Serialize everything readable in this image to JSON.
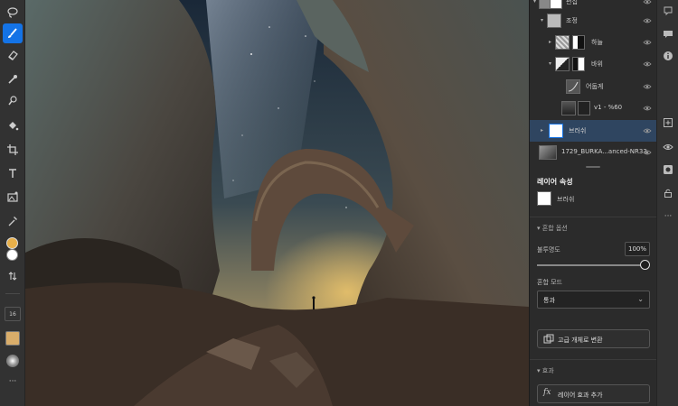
{
  "toolbar": {
    "tools": [
      "lasso-icon",
      "brush-icon",
      "eraser-icon",
      "eyedropper-heal-icon",
      "smudge-icon",
      "fill-icon",
      "crop-icon",
      "text-icon",
      "image-placement-icon",
      "color-picker-icon"
    ],
    "brush_size": "16",
    "foreground_color": "#e8b04a",
    "background_color": "#ffffff",
    "brush_color": "#d9ad6a",
    "more": "···"
  },
  "layers": [
    {
      "name": "편집",
      "indent": 0
    },
    {
      "name": "조정",
      "indent": 1
    },
    {
      "name": "하늘",
      "indent": 2
    },
    {
      "name": "바위",
      "indent": 2
    },
    {
      "name": "어둡게",
      "indent": 3
    },
    {
      "name": "v1 - %60",
      "indent": 3
    },
    {
      "name": "브러쉬",
      "indent": 1
    },
    {
      "name": "1729_BURKA...anced-NR33",
      "indent": 0
    }
  ],
  "properties": {
    "title": "레이어 속성",
    "layer_name": "브러쉬",
    "blend_section": "혼합 옵션",
    "opacity_label": "불투명도",
    "opacity_value": "100%",
    "opacity_level": 1.0,
    "blend_mode_label": "혼합 모드",
    "blend_mode_value": "통과",
    "smart_object_button": "고급 개체로 변환",
    "effects_section": "효과",
    "add_effect_button": "레이어 효과 추가"
  },
  "rail": {
    "more": "···"
  }
}
